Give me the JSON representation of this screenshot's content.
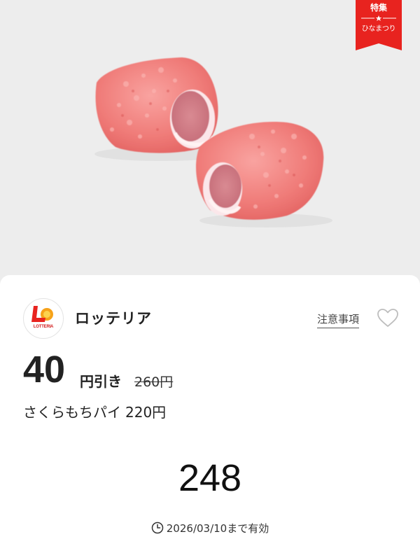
{
  "ribbon": {
    "title": "特集",
    "subtitle": "ひなまつり",
    "color": "#e8231f"
  },
  "product_image": {
    "icon": "sakura-mochi-pie-image"
  },
  "card": {
    "brand": {
      "logo_text": "LOTTERIA",
      "name": "ロッテリア"
    },
    "notes_label": "注意事項",
    "favorite_icon": "heart-outline-icon",
    "discount": {
      "amount": "40",
      "unit": "円引き",
      "original_price": "260円"
    },
    "product": {
      "name": "さくらもちパイ",
      "price": "220円"
    },
    "code": "248",
    "validity": {
      "icon": "clock-icon",
      "text": "2026/03/10まで有効"
    }
  },
  "colors": {
    "accent_red": "#e8231f",
    "background": "#ededed",
    "card": "#ffffff",
    "text": "#222222"
  }
}
